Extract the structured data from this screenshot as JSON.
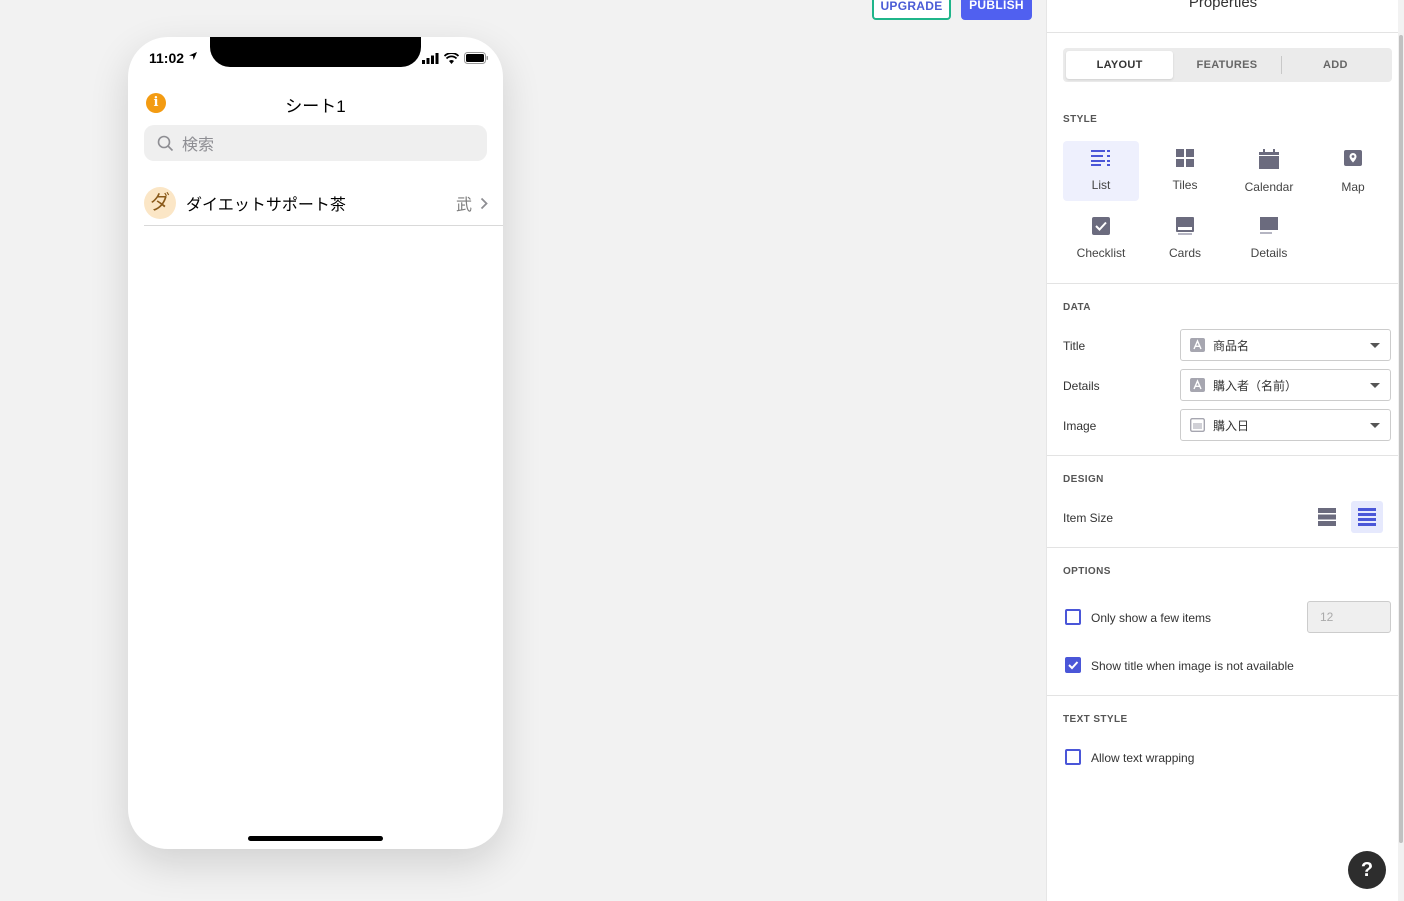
{
  "toolbar": {
    "upgrade_label": "UPGRADE",
    "publish_label": "PUBLISH"
  },
  "phone": {
    "status_time": "11:02",
    "screen_title": "シート1",
    "info_badge": "i",
    "search_placeholder": "検索",
    "list_items": [
      {
        "avatar_text": "ダ",
        "title": "ダイエットサポート茶",
        "detail": "武"
      }
    ]
  },
  "panel": {
    "title": "Properties",
    "tabs": [
      "LAYOUT",
      "FEATURES",
      "ADD"
    ],
    "active_tab": "LAYOUT",
    "style_section": "STYLE",
    "styles": [
      "List",
      "Tiles",
      "Calendar",
      "Map",
      "Checklist",
      "Cards",
      "Details"
    ],
    "active_style": "List",
    "data_section": "DATA",
    "data_fields": [
      {
        "label": "Title",
        "value": "商品名",
        "type_icon": "text-type-icon"
      },
      {
        "label": "Details",
        "value": "購入者（名前）",
        "type_icon": "text-type-icon"
      },
      {
        "label": "Image",
        "value": "購入日",
        "type_icon": "date-type-icon"
      }
    ],
    "design_section": "DESIGN",
    "item_size_label": "Item Size",
    "options_section": "OPTIONS",
    "only_show_few_label": "Only show a few items",
    "only_show_few_checked": false,
    "few_items_count": "12",
    "show_title_label": "Show title when image is not available",
    "show_title_checked": true,
    "text_style_section": "TEXT STYLE",
    "allow_wrap_label": "Allow text wrapping",
    "allow_wrap_checked": false
  },
  "help_label": "?",
  "colors": {
    "accent": "#4a56d8",
    "publish": "#5060f0",
    "upgrade_border": "#1fb58a",
    "info_badge": "#f39b12"
  }
}
